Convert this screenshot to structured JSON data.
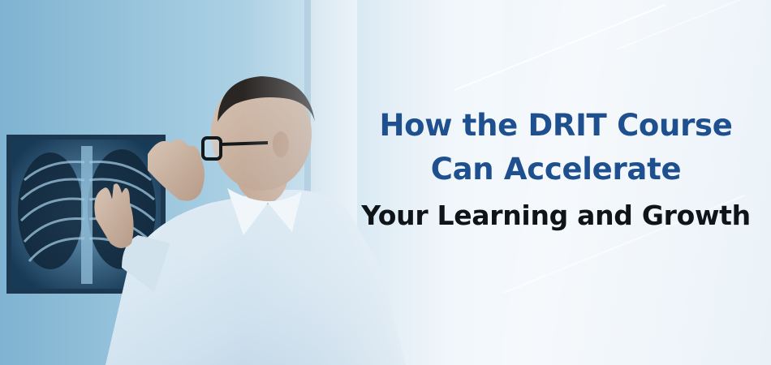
{
  "banner": {
    "headline_line1": "How the DRIT Course",
    "headline_line2": "Can Accelerate",
    "headline_line3": "Your Learning and Growth"
  },
  "colors": {
    "headline_blue": "#1e4f8f",
    "headline_black": "#0f1418",
    "background": "#eef5fb"
  },
  "photo": {
    "subject": "doctor examining chest x-ray on light box"
  }
}
